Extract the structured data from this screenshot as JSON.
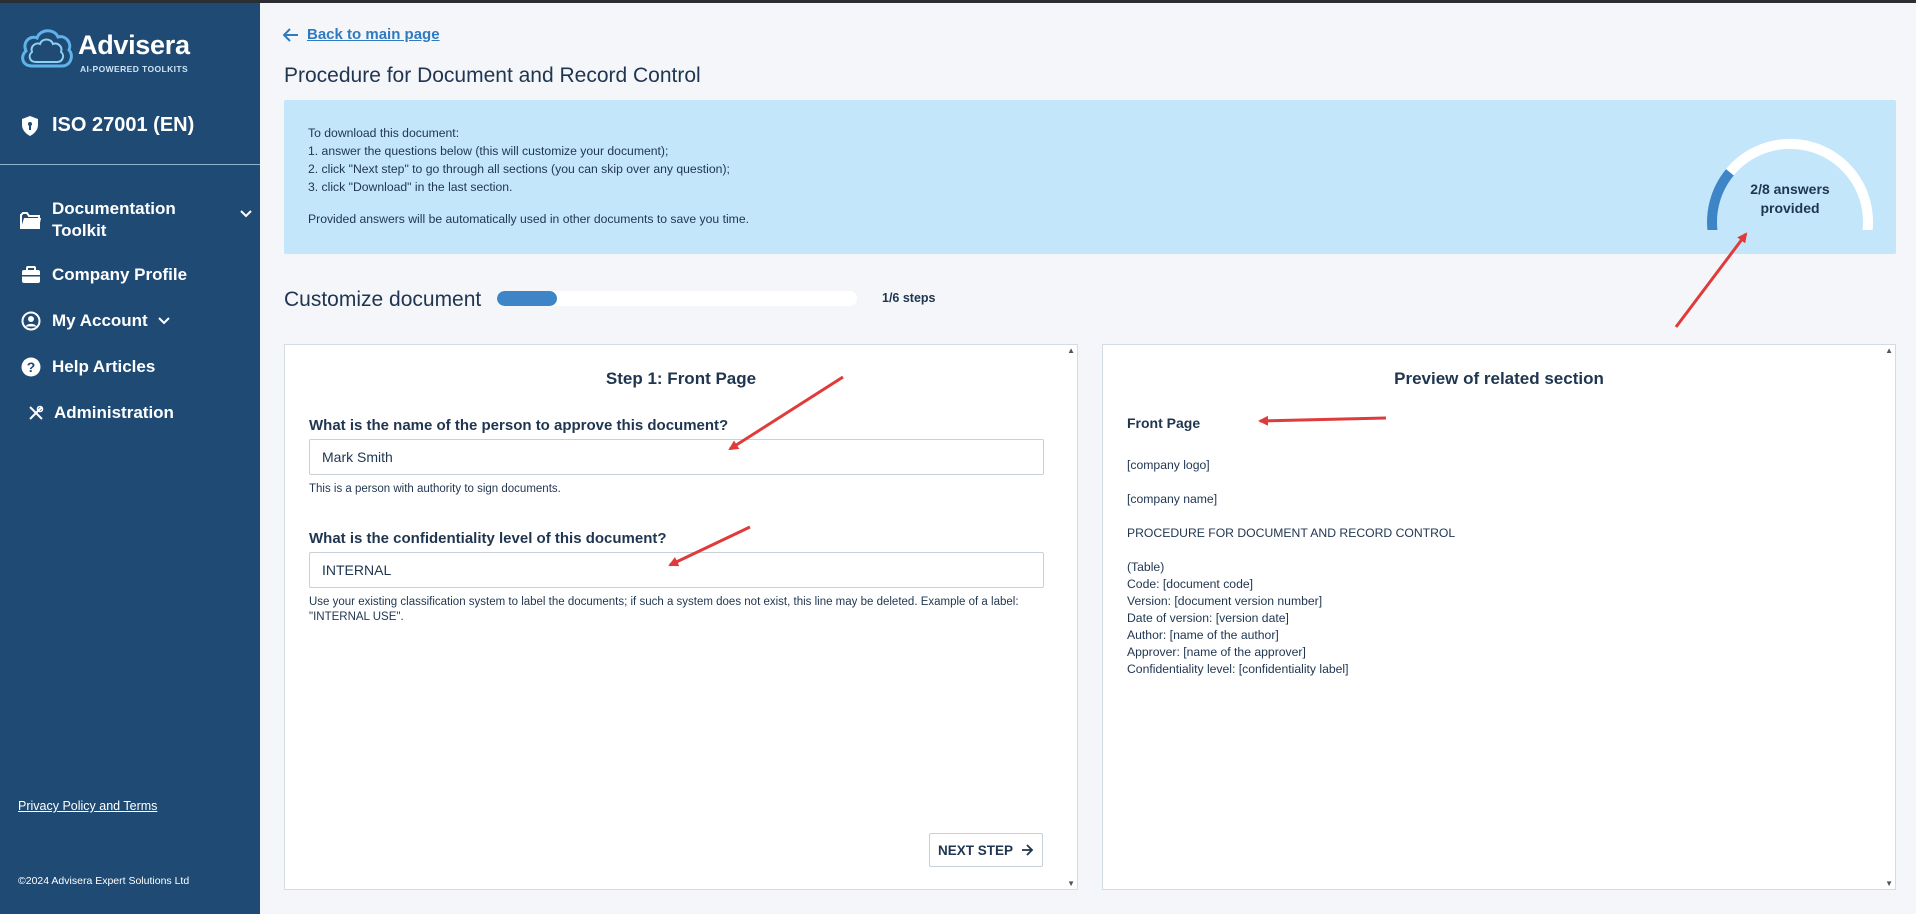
{
  "sidebar": {
    "logo": {
      "name": "Advisera",
      "tagline": "AI-POWERED TOOLKITS"
    },
    "toolkit": "ISO 27001 (EN)",
    "nav": [
      {
        "label": "Documentation Toolkit",
        "icon": "folder-icon"
      },
      {
        "label": "Company Profile",
        "icon": "briefcase-icon"
      },
      {
        "label": "My Account",
        "icon": "user-circle-icon"
      },
      {
        "label": "Help Articles",
        "icon": "question-circle-icon"
      },
      {
        "label": "Administration",
        "icon": "tools-icon"
      }
    ],
    "privacy": "Privacy Policy and Terms",
    "copyright": "©2024 Advisera Expert Solutions Ltd"
  },
  "header": {
    "back_link": "Back to main page",
    "title": "Procedure for Document and Record Control"
  },
  "banner": {
    "lines": [
      "To download this document:",
      "1. answer the questions below (this will customize your document);",
      "2. click \"Next step\" to go through all sections (you can skip over any question);",
      "3. click \"Download\" in the last section."
    ],
    "note": "Provided answers will be automatically used in other documents to save you time.",
    "gauge": {
      "label_line1": "2/8 answers",
      "label_line2": "provided",
      "answered": 2,
      "total": 8,
      "fill_color": "#3d85c6"
    }
  },
  "customize": {
    "title": "Customize document",
    "steps_label": "1/6 steps",
    "current_step": 1,
    "total_steps": 6
  },
  "step": {
    "heading": "Step 1: Front Page",
    "questions": [
      {
        "label": "What is the name of the person to approve this document?",
        "value": "Mark Smith",
        "help": "This is a person with authority to sign documents."
      },
      {
        "label": "What is the confidentiality level of this document?",
        "value": "INTERNAL",
        "help": "Use your existing classification system to label the documents; if such a system does not exist, this line may be deleted. Example of a label: \"INTERNAL USE\"."
      }
    ],
    "next_button": "NEXT STEP"
  },
  "preview": {
    "heading": "Preview of related section",
    "section_title": "Front Page",
    "lines": [
      "[company logo]",
      "",
      "[company name]",
      "",
      "PROCEDURE FOR DOCUMENT AND RECORD CONTROL",
      "",
      "(Table)",
      "Code: [document code]",
      "Version: [document version number]",
      "Date of version: [version date]",
      "Author: [name of the author]",
      "Approver: [name of the approver]",
      "Confidentiality level: [confidentiality label]"
    ]
  },
  "colors": {
    "sidebar": "#1f4a73",
    "accent": "#3d85c6",
    "banner": "#c3e6fb",
    "annotation": "#e03b3b"
  }
}
